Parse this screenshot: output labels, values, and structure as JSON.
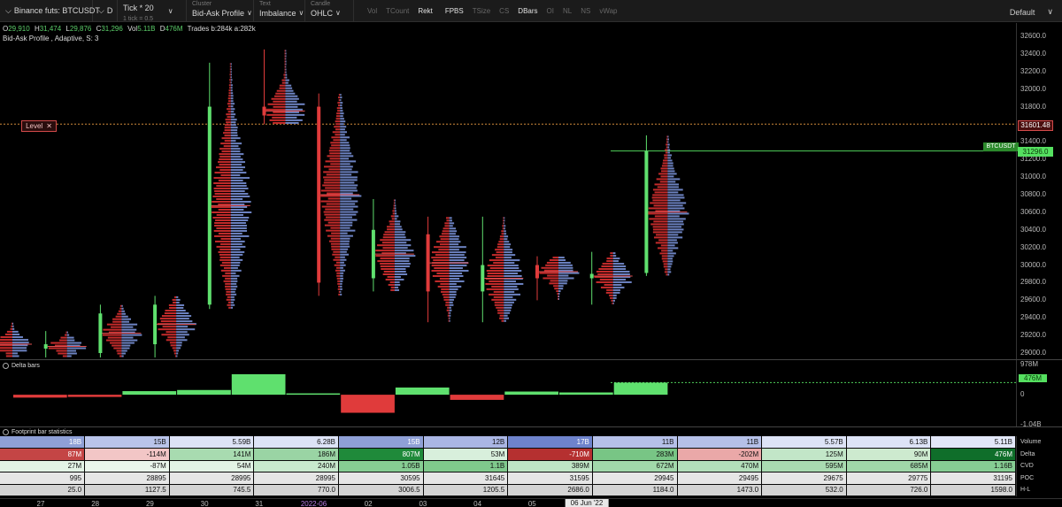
{
  "toolbar": {
    "symbol": "Binance futs: BTCUSDT",
    "timeframe": "D",
    "tick_main": "Tick * 20",
    "tick_sub": "1 tick = 0.5",
    "cluster_label": "Cluster",
    "cluster_value": "Bid-Ask Profile",
    "text_label": "Text",
    "text_value": "Imbalance",
    "candle_label": "Candle",
    "candle_value": "OHLC",
    "flags": [
      {
        "label": "Vol",
        "on": false
      },
      {
        "label": "TCount",
        "on": false
      },
      {
        "label": "Rekt",
        "on": true
      },
      {
        "label": "FPBS",
        "on": true
      },
      {
        "label": "TSize",
        "on": false
      },
      {
        "label": "CS",
        "on": false
      },
      {
        "label": "DBars",
        "on": true
      },
      {
        "label": "OI",
        "on": false
      },
      {
        "label": "NL",
        "on": false
      },
      {
        "label": "NS",
        "on": false
      },
      {
        "label": "vWap",
        "on": false
      }
    ],
    "template": "Default"
  },
  "ohlc": {
    "o_label": "O",
    "o": "29,910",
    "h_label": "H",
    "h": "31,474",
    "l_label": "L",
    "l": "29,876",
    "c_label": "C",
    "c": "31,296",
    "vol_label": "Vol",
    "vol": "5.11B",
    "d_label": "D",
    "d": "476M",
    "trades": "Trades b:284k a:282k"
  },
  "indicator_line": "Bid-Ask Profile , Adaptive, S: 3",
  "price_axis": {
    "min": 29000,
    "max": 32600,
    "ticks": [
      "32600.0",
      "32400.0",
      "32200.0",
      "32000.0",
      "31800.0",
      "31600.0",
      "31400.0",
      "31200.0",
      "31000.0",
      "30800.0",
      "30600.0",
      "30400.0",
      "30200.0",
      "30000.0",
      "29800.0",
      "29600.0",
      "29400.0",
      "29200.0",
      "29000.0"
    ],
    "level_label": "Level",
    "level_close": "✕",
    "level_price": "31601.48",
    "level_value": 31601.48,
    "symbol_tag": "BTCUSDT",
    "last_price": "31296.0",
    "last_value": 31296
  },
  "candles": [
    {
      "o": 29150,
      "h": 29350,
      "l": 28950,
      "c": 29050
    },
    {
      "o": 29050,
      "h": 29250,
      "l": 28950,
      "c": 29100
    },
    {
      "o": 29000,
      "h": 29550,
      "l": 28950,
      "c": 29450
    },
    {
      "o": 29100,
      "h": 29650,
      "l": 28950,
      "c": 29550
    },
    {
      "o": 29550,
      "h": 32300,
      "l": 29500,
      "c": 31800
    },
    {
      "o": 31800,
      "h": 32450,
      "l": 31600,
      "c": 31700
    },
    {
      "o": 31800,
      "h": 31950,
      "l": 29650,
      "c": 29800
    },
    {
      "o": 29850,
      "h": 30750,
      "l": 29700,
      "c": 30400
    },
    {
      "o": 30350,
      "h": 30550,
      "l": 29350,
      "c": 29700
    },
    {
      "o": 29700,
      "h": 30550,
      "l": 29350,
      "c": 30000
    },
    {
      "o": 30000,
      "h": 30100,
      "l": 29600,
      "c": 29850
    },
    {
      "o": 29850,
      "h": 30150,
      "l": 29550,
      "c": 29900
    },
    {
      "o": 29910,
      "h": 31474,
      "l": 29876,
      "c": 31296
    }
  ],
  "delta_panel": {
    "title": "Delta bars",
    "axis_top": "978M",
    "axis_current": "476M",
    "axis_zero": "0",
    "axis_bottom": "-1.04B",
    "max": 978,
    "min": -1040,
    "values": [
      -114,
      -87,
      141,
      186,
      807,
      53,
      -710,
      283,
      -202,
      125,
      90,
      476
    ]
  },
  "footprint": {
    "title": "Footprint bar statistics",
    "row_labels": [
      "Volume",
      "Delta",
      "CVD",
      "POC",
      "H-L"
    ],
    "rows": [
      [
        "18B",
        "15B",
        "5.59B",
        "6.28B",
        "15B",
        "12B",
        "17B",
        "11B",
        "11B",
        "5.57B",
        "6.13B",
        "5.11B"
      ],
      [
        "87M",
        "-114M",
        "141M",
        "186M",
        "807M",
        "53M",
        "-710M",
        "283M",
        "-202M",
        "125M",
        "90M",
        "476M"
      ],
      [
        "27M",
        "-87M",
        "54M",
        "240M",
        "1.05B",
        "1.1B",
        "389M",
        "672M",
        "470M",
        "595M",
        "685M",
        "1.16B"
      ],
      [
        "995",
        "28895",
        "28995",
        "28995",
        "30595",
        "31645",
        "31595",
        "29945",
        "29495",
        "29675",
        "29775",
        "31195"
      ],
      [
        "25.0",
        "1127.5",
        "745.5",
        "770.0",
        "3006.5",
        "1205.5",
        "2686.0",
        "1184.0",
        "1473.0",
        "532.0",
        "726.0",
        "1598.0"
      ]
    ],
    "colors": [
      [
        "#8fa0d6",
        "#b9c4ea",
        "#dde3f6",
        "#dde3f6",
        "#8fa0d6",
        "#aab6e4",
        "#6e83cc",
        "#b5c0e8",
        "#b5c0e8",
        "#dde3f6",
        "#dde3f6",
        "#e2e7f8"
      ],
      [
        "#c44545",
        "#f2c6c6",
        "#a8dbb0",
        "#9ad4a4",
        "#1f8a3a",
        "#d8efdc",
        "#b53030",
        "#78c585",
        "#eaa8a8",
        "#c2e6c8",
        "#cdeacf",
        "#0f6e2a"
      ],
      [
        "#e2f3e5",
        "#eaf6ec",
        "#e2f3e5",
        "#c8e9cd",
        "#86cd93",
        "#7fc98c",
        "#bfe5c5",
        "#a1d8aa",
        "#b3dfba",
        "#a9dbb1",
        "#a0d7a9",
        "#86cd93"
      ],
      [
        "#e6e6e6",
        "#e6e6e6",
        "#e6e6e6",
        "#e6e6e6",
        "#e6e6e6",
        "#e6e6e6",
        "#e6e6e6",
        "#e6e6e6",
        "#e6e6e6",
        "#e6e6e6",
        "#e6e6e6",
        "#e6e6e6"
      ],
      [
        "#d4d4d4",
        "#d4d4d4",
        "#d4d4d4",
        "#d4d4d4",
        "#d4d4d4",
        "#d4d4d4",
        "#d4d4d4",
        "#d4d4d4",
        "#d4d4d4",
        "#d4d4d4",
        "#d4d4d4",
        "#d4d4d4"
      ]
    ]
  },
  "dates": [
    "27",
    "28",
    "29",
    "30",
    "31",
    "2022-06",
    "02",
    "03",
    "04",
    "05",
    "06 Jun '22"
  ],
  "colors": {
    "up": "#5fe06e",
    "down": "#e03b3b",
    "bid": "#c42b2b",
    "ask": "#6d83c2",
    "accent": "#d24a4a"
  }
}
